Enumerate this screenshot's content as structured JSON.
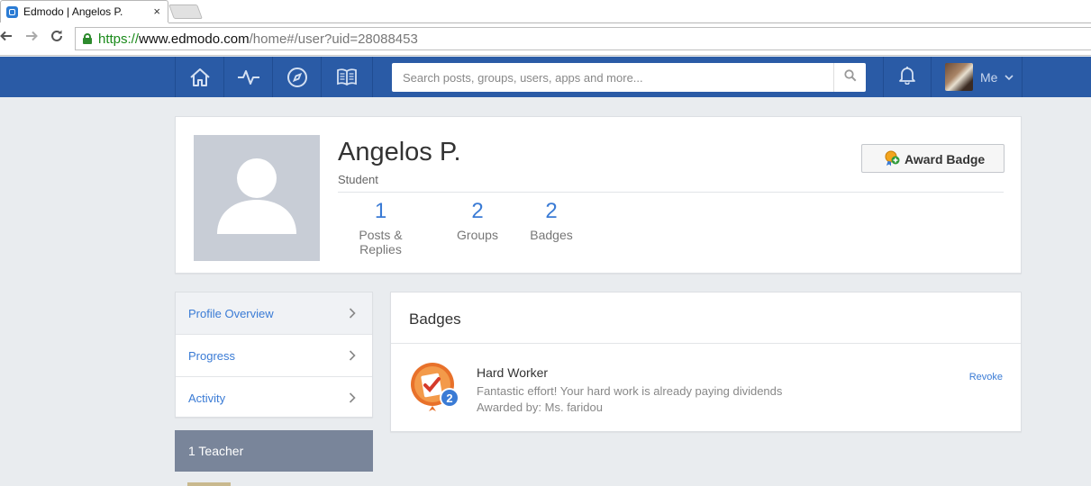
{
  "browser": {
    "tab_title": "Edmodo | Angelos P.",
    "tab_close": "×",
    "url_scheme": "https://",
    "url_host": "www.edmodo.com",
    "url_path": "/home#/user?uid=28088453"
  },
  "header": {
    "search_placeholder": "Search posts, groups, users, apps and more...",
    "me_label": "Me",
    "nav_icons": [
      "home-icon",
      "activity-icon",
      "compass-icon",
      "book-icon"
    ]
  },
  "profile": {
    "name": "Angelos P.",
    "role": "Student",
    "award_button": "Award Badge",
    "stats": [
      {
        "value": "1",
        "label": "Posts & Replies"
      },
      {
        "value": "2",
        "label": "Groups"
      },
      {
        "value": "2",
        "label": "Badges"
      }
    ]
  },
  "sidenav": {
    "items": [
      {
        "label": "Profile Overview"
      },
      {
        "label": "Progress"
      },
      {
        "label": "Activity"
      }
    ],
    "teacher_header": "1 Teacher"
  },
  "badges": {
    "title": "Badges",
    "items": [
      {
        "name": "Hard Worker",
        "description": "Fantastic effort! Your hard work is already paying dividends",
        "awarded_by": "Awarded by: Ms. faridou",
        "count": "2",
        "action": "Revoke"
      }
    ]
  },
  "colors": {
    "brand_blue": "#2a5ba6",
    "link_blue": "#3a7bd5",
    "page_bg": "#e9ecef"
  }
}
